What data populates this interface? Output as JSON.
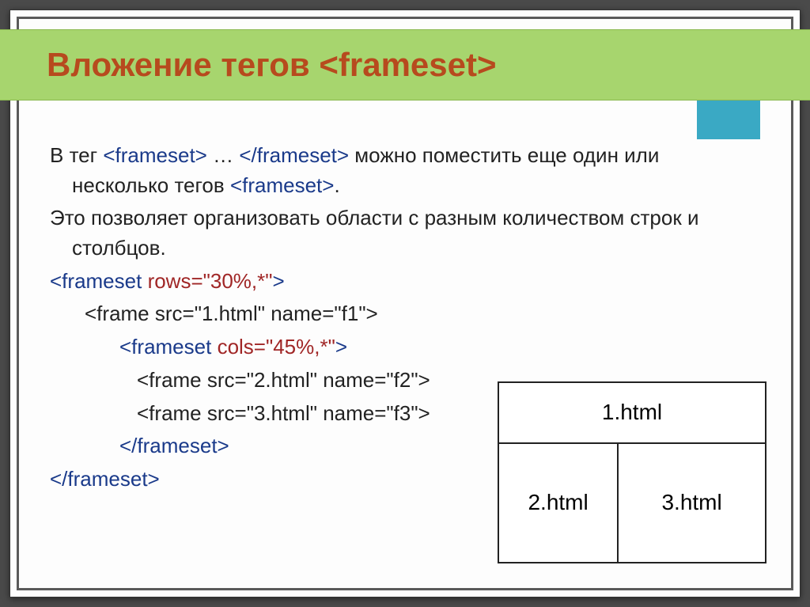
{
  "title": "Вложение тегов <frameset>",
  "para1_a": "В тег ",
  "para1_tag_open": "<frameset>",
  "para1_ellipsis": " … ",
  "para1_tag_close": "</frameset>",
  "para1_b": " можно поместить еще один или несколько тегов ",
  "para1_tag_last": "<frameset>",
  "para1_c": ".",
  "para2": "Это позволяет организовать области с разным количеством строк и столбцов.",
  "code": {
    "l1_a": "<frameset ",
    "l1_b": "rows=\"30%,*\"",
    "l1_c": ">",
    "l2": "<frame src=\"1.html\" name=\"f1\">",
    "l3_a": "<frameset ",
    "l3_b": "cols=\"45%,*\"",
    "l3_c": ">",
    "l4": "<frame src=\"2.html\" name=\"f2\">",
    "l5": "<frame src=\"3.html\" name=\"f3\">",
    "l6": "</frameset>",
    "l7": "</frameset>"
  },
  "diagram": {
    "top": "1.html",
    "left": "2.html",
    "right": "3.html"
  }
}
